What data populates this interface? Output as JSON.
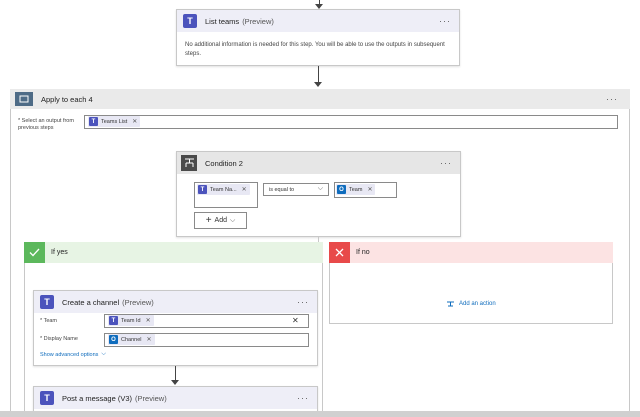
{
  "list_teams": {
    "title": "List teams",
    "preview": "(Preview)",
    "body": "No additional information is needed for this step. You will be able to use the outputs in subsequent steps."
  },
  "apply_each": {
    "title": "Apply to each 4",
    "select_label": "* Select an output from previous steps",
    "token": "Teams List"
  },
  "condition": {
    "title": "Condition 2",
    "left_token": "Team Na...",
    "operator": "is equal to",
    "right_token": "Team",
    "add_label": "Add"
  },
  "if_yes": {
    "label": "If yes"
  },
  "if_no": {
    "label": "If no",
    "add_action": "Add an action"
  },
  "create_channel": {
    "title": "Create a channel",
    "preview": "(Preview)",
    "team_label": "* Team",
    "team_token": "Team Id",
    "display_name_label": "* Display Name",
    "display_name_token": "Channel",
    "advanced": "Show advanced options"
  },
  "post_message": {
    "title": "Post a message (V3)",
    "preview": "(Preview)"
  },
  "colors": {
    "teams": "#4b53bc",
    "yes_bar": "#5cb85c",
    "no_bar": "#e84a4a",
    "no_bg": "#fce3e3",
    "loop_header": "#eaeaea",
    "condition_header": "#e6e6e6"
  }
}
